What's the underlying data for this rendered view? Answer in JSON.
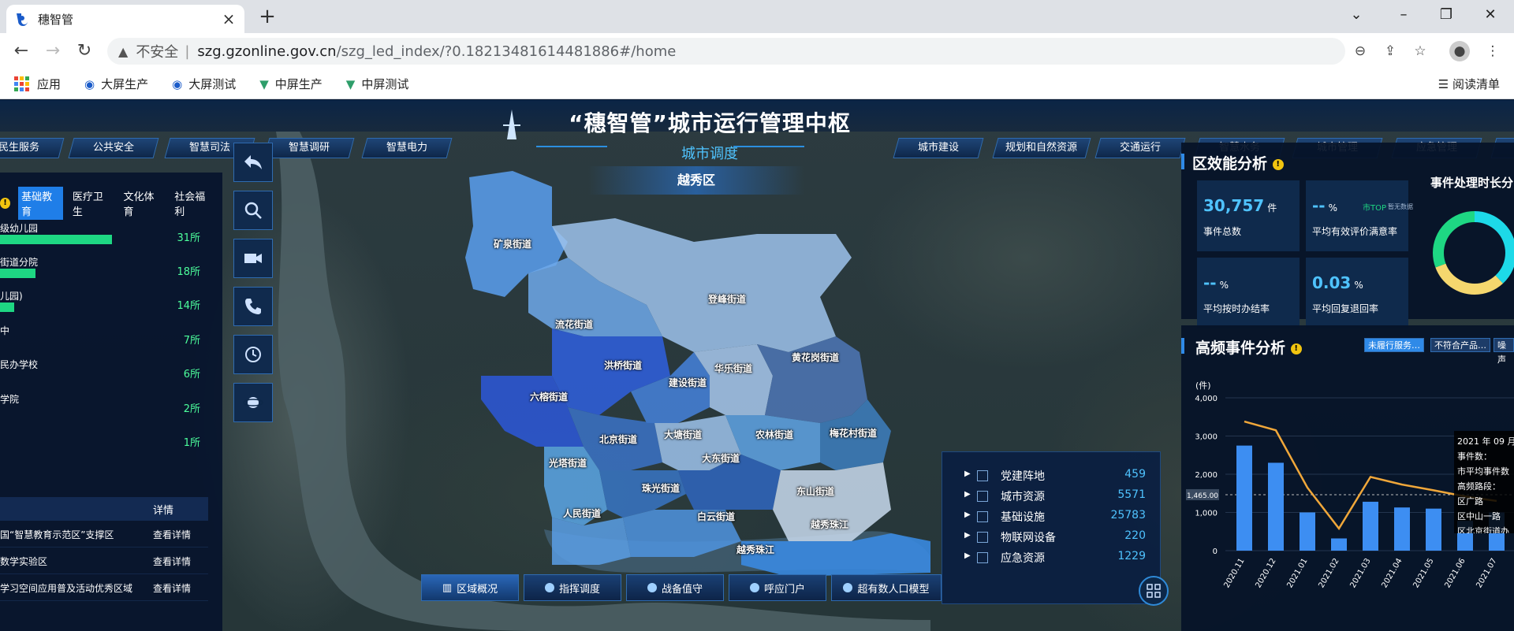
{
  "browser": {
    "tab_title": "穗智管",
    "tab_close": "×",
    "new_tab": "+",
    "url_warning": "不安全",
    "url_domain": "szg.gzonline.gov.cn",
    "url_path": "/szg_led_index/?0.18213481614481886#/home",
    "bookmarks": [
      "应用",
      "大屏生产",
      "大屏测试",
      "中屏生产",
      "中屏测试"
    ],
    "reading_list": "阅读清单"
  },
  "header": {
    "title": "“穗智管”城市运行管理中枢",
    "subtitle": "城市调度"
  },
  "nav_left": [
    "民生服务",
    "公共安全",
    "智慧司法",
    "智慧调研",
    "智慧电力"
  ],
  "nav_right": [
    "城市建设",
    "规划和自然资源",
    "交通运行",
    "智慧水务",
    "城市管理",
    "应急管理"
  ],
  "left_panel": {
    "tabs": [
      "基础教育",
      "医疗卫生",
      "文化体育",
      "社会福利"
    ],
    "rows": [
      {
        "label": "级幼儿园",
        "value": "31所",
        "pct": 1.0
      },
      {
        "label": "街道分院",
        "value": "18所",
        "pct": 0.32
      },
      {
        "label": "儿园)",
        "value": "14所",
        "pct": 0.13
      },
      {
        "label": "中",
        "value": "7所",
        "pct": 0
      },
      {
        "label": "民办学校",
        "value": "6所",
        "pct": 0
      },
      {
        "label": "学院",
        "value": "2所",
        "pct": 0
      },
      {
        "label": "",
        "value": "1所",
        "pct": 0
      }
    ],
    "table_header": "详情",
    "table_rows": [
      {
        "name": "国“智慧教育示范区”支撑区",
        "detail": "查看详情"
      },
      {
        "name": "数学实验区",
        "detail": "查看详情"
      },
      {
        "name": "学习空间应用普及活动优秀区域",
        "detail": "查看详情"
      }
    ]
  },
  "district": "越秀区",
  "map_labels": [
    {
      "text": "矿泉街道"
    },
    {
      "text": "登峰街道"
    },
    {
      "text": "流花街道"
    },
    {
      "text": "洪桥街道"
    },
    {
      "text": "六榕街道"
    },
    {
      "text": "建设街道"
    },
    {
      "text": "华乐街道"
    },
    {
      "text": "黄花岗街道"
    },
    {
      "text": "北京街道"
    },
    {
      "text": "大塘街道"
    },
    {
      "text": "农林街道"
    },
    {
      "text": "梅花村街道"
    },
    {
      "text": "光塔街道"
    },
    {
      "text": "大东街道"
    },
    {
      "text": "珠光街道"
    },
    {
      "text": "东山街道"
    },
    {
      "text": "人民街道"
    },
    {
      "text": "白云街道"
    },
    {
      "text": "越秀珠江"
    },
    {
      "text": "越秀珠江"
    }
  ],
  "legend": [
    {
      "name": "党建阵地",
      "value": "459"
    },
    {
      "name": "城市资源",
      "value": "5571"
    },
    {
      "name": "基础设施",
      "value": "25783"
    },
    {
      "name": "物联网设备",
      "value": "220"
    },
    {
      "name": "应急资源",
      "value": "1229"
    }
  ],
  "bottom_buttons": [
    "区域概况",
    "指挥调度",
    "战备值守",
    "呼应门户",
    "超有数人口模型"
  ],
  "efficiency": {
    "title": "区效能分析",
    "side_title": "事件处理时长分",
    "cards": [
      {
        "value": "30,757",
        "unit": "件",
        "label": "事件总数"
      },
      {
        "value": "--",
        "unit": "%",
        "label": "平均有效评价满意率",
        "tag": "市TOP",
        "tag2": "暂无数据"
      },
      {
        "value": "--",
        "unit": "%",
        "label": "平均按时办结率"
      },
      {
        "value": "0.03",
        "unit": "%",
        "label": "平均回复退回率"
      }
    ]
  },
  "high_freq": {
    "title": "高频事件分析",
    "chips": [
      "未履行服务…",
      "不符合产品…",
      "噪声"
    ],
    "tooltip": [
      "2021 年 09 月",
      "事件数：",
      "市平均事件数",
      "高频路段：",
      "区广路",
      "区中山一路",
      "区北京街道办"
    ],
    "unit_label": "(件)",
    "mean_label": "1,465.00"
  },
  "chart_data": {
    "type": "bar",
    "title": "",
    "ylabel": "(件)",
    "ylim": [
      0,
      4000
    ],
    "yticks": [
      "0",
      "1,000",
      "2,000",
      "3,000",
      "4,000"
    ],
    "categories": [
      "2020.11",
      "2020.12",
      "2021.01",
      "2021.02",
      "2021.03",
      "2021.04",
      "2021.05",
      "2021.06",
      "2021.07"
    ],
    "series": [
      {
        "type": "bar",
        "values": [
          2750,
          2300,
          1000,
          320,
          1280,
          1130,
          1100,
          780,
          1000
        ]
      },
      {
        "type": "line",
        "values": [
          3380,
          3150,
          1650,
          580,
          1930,
          1730,
          1580,
          1420,
          1300
        ]
      }
    ],
    "mean": 1465
  },
  "colors": {
    "accent": "#2f8ae8",
    "bar": "#3d8ef2",
    "line": "#f0a73a",
    "green": "#1ed783"
  }
}
